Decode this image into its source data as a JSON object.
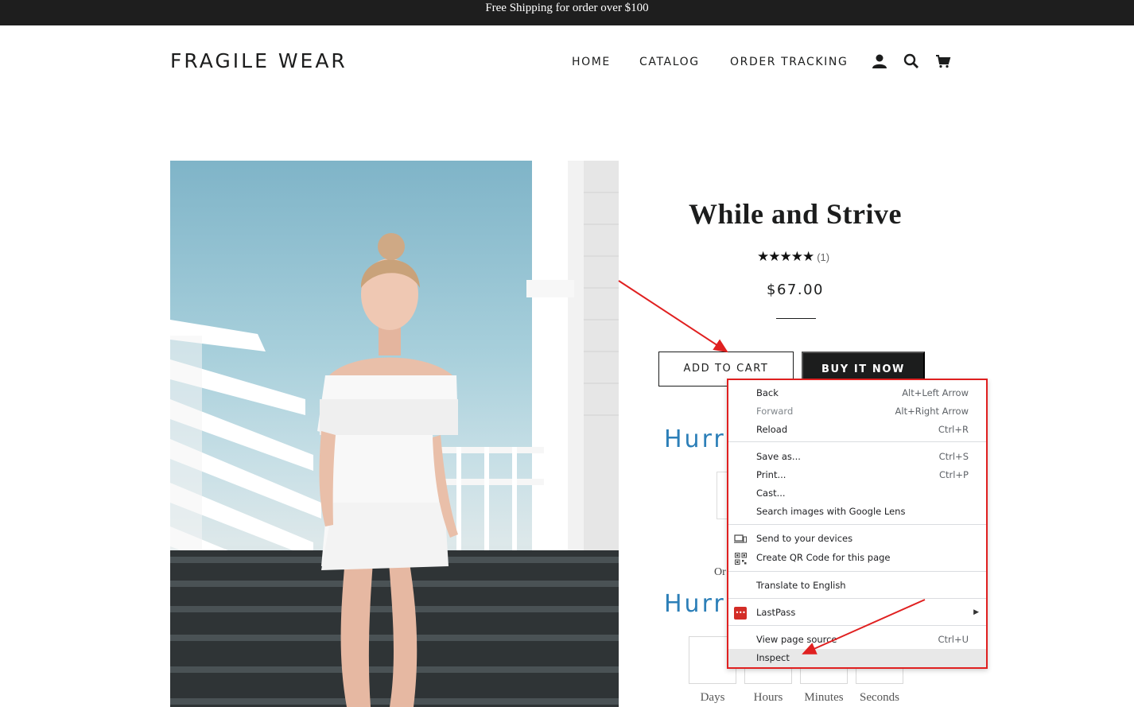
{
  "announcement": "Free Shipping for order over $100",
  "header": {
    "logo": "FRAGILE WEAR",
    "nav": [
      "HOME",
      "CATALOG",
      "ORDER TRACKING"
    ],
    "icons": [
      "account-icon",
      "search-icon",
      "cart-icon"
    ]
  },
  "product": {
    "title": "While and Strive",
    "stars": "★★★★★",
    "rating_count": "(1)",
    "price": "$67.00",
    "add_to_cart": "ADD TO CART",
    "buy_now": "BUY IT NOW",
    "hurry_text_1": "Hurr",
    "hurry_text_2": "Hurr",
    "partial_text": "Or",
    "countdown_labels": [
      "Days",
      "Hours",
      "Minutes",
      "Seconds"
    ]
  },
  "context_menu": {
    "items": [
      {
        "label": "Back",
        "shortcut": "Alt+Left Arrow"
      },
      {
        "label": "Forward",
        "shortcut": "Alt+Right Arrow"
      },
      {
        "label": "Reload",
        "shortcut": "Ctrl+R"
      },
      {
        "label": "Save as...",
        "shortcut": "Ctrl+S"
      },
      {
        "label": "Print...",
        "shortcut": "Ctrl+P"
      },
      {
        "label": "Cast...",
        "shortcut": ""
      },
      {
        "label": "Search images with Google Lens",
        "shortcut": ""
      },
      {
        "label": "Send to your devices",
        "shortcut": ""
      },
      {
        "label": "Create QR Code for this page",
        "shortcut": ""
      },
      {
        "label": "Translate to English",
        "shortcut": ""
      },
      {
        "label": "LastPass",
        "shortcut": ""
      },
      {
        "label": "View page source",
        "shortcut": "Ctrl+U"
      },
      {
        "label": "Inspect",
        "shortcut": ""
      }
    ],
    "lastpass_badge": "•••"
  },
  "colors": {
    "announcement_bg": "#1e1e1e",
    "accent_blue": "#2c7fb8",
    "annotation_red": "#e02020"
  }
}
